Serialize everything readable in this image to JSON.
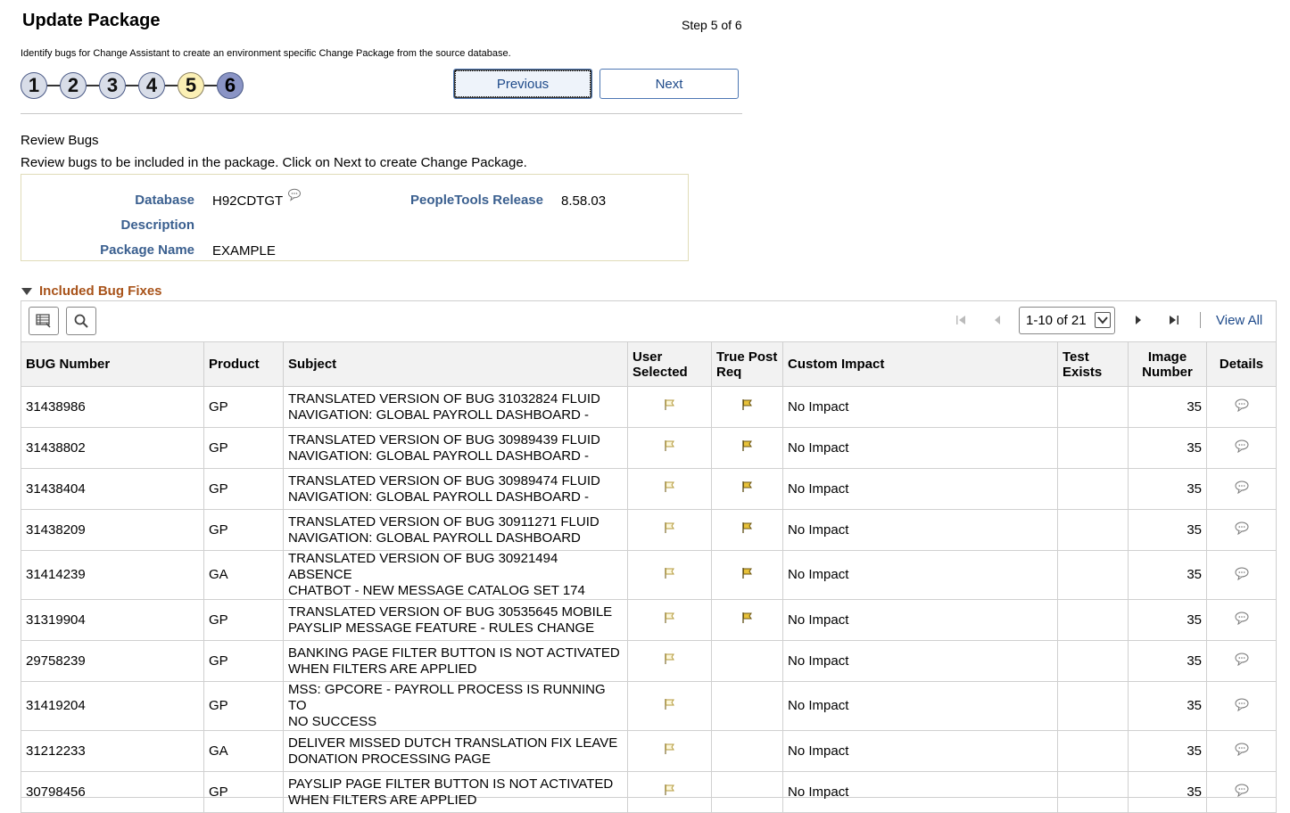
{
  "header": {
    "title": "Update Package",
    "step_text": "Step 5 of 6",
    "instructions": "Identify bugs for Change Assistant to create an environment specific Change Package from the source database."
  },
  "steps": [
    {
      "label": "1",
      "state": "visited"
    },
    {
      "label": "2",
      "state": "visited"
    },
    {
      "label": "3",
      "state": "visited"
    },
    {
      "label": "4",
      "state": "visited"
    },
    {
      "label": "5",
      "state": "current"
    },
    {
      "label": "6",
      "state": "next"
    }
  ],
  "buttons": {
    "previous": "Previous",
    "next": "Next"
  },
  "review": {
    "title": "Review Bugs",
    "description": "Review bugs to be included in the package.  Click on Next to create Change Package."
  },
  "info": {
    "database_label": "Database",
    "database_value": "H92CDTGT",
    "tools_label": "PeopleTools Release",
    "tools_value": "8.58.03",
    "description_label": "Description",
    "description_value": "",
    "package_label": "Package Name",
    "package_value": "EXAMPLE"
  },
  "grid": {
    "section_title": "Included Bug Fixes",
    "pager_text": "1-10 of 21",
    "view_all": "View All",
    "columns": {
      "bug": "BUG Number",
      "product": "Product",
      "subject": "Subject",
      "user_selected_1": "User",
      "user_selected_2": "Selected",
      "true_post_1": "True Post",
      "true_post_2": "Req",
      "custom_impact": "Custom Impact",
      "test_exists_1": "Test",
      "test_exists_2": "Exists",
      "image_number_1": "Image",
      "image_number_2": "Number",
      "details": "Details"
    },
    "rows": [
      {
        "bug": "31438986",
        "product": "GP",
        "subject1": "TRANSLATED VERSION OF BUG 31032824 FLUID",
        "subject2": "NAVIGATION: GLOBAL PAYROLL DASHBOARD -",
        "user_selected": true,
        "true_post": true,
        "impact": "No Impact",
        "test": "",
        "image": "35"
      },
      {
        "bug": "31438802",
        "product": "GP",
        "subject1": "TRANSLATED VERSION OF BUG 30989439 FLUID",
        "subject2": "NAVIGATION: GLOBAL PAYROLL DASHBOARD -",
        "user_selected": true,
        "true_post": true,
        "impact": "No Impact",
        "test": "",
        "image": "35"
      },
      {
        "bug": "31438404",
        "product": "GP",
        "subject1": "TRANSLATED VERSION OF BUG 30989474 FLUID",
        "subject2": "NAVIGATION: GLOBAL PAYROLL DASHBOARD -",
        "user_selected": true,
        "true_post": true,
        "impact": "No Impact",
        "test": "",
        "image": "35"
      },
      {
        "bug": "31438209",
        "product": "GP",
        "subject1": "TRANSLATED VERSION OF BUG 30911271 FLUID",
        "subject2": "NAVIGATION: GLOBAL PAYROLL DASHBOARD",
        "user_selected": true,
        "true_post": true,
        "impact": "No Impact",
        "test": "",
        "image": "35"
      },
      {
        "bug": "31414239",
        "product": "GA",
        "subject1": "TRANSLATED VERSION OF BUG 30921494 ABSENCE",
        "subject2": "CHATBOT - NEW MESSAGE CATALOG SET 174",
        "user_selected": true,
        "true_post": true,
        "impact": "No Impact",
        "test": "",
        "image": "35"
      },
      {
        "bug": "31319904",
        "product": "GP",
        "subject1": "TRANSLATED VERSION OF BUG 30535645 MOBILE",
        "subject2": "PAYSLIP MESSAGE FEATURE - RULES CHANGE",
        "user_selected": true,
        "true_post": true,
        "impact": "No Impact",
        "test": "",
        "image": "35"
      },
      {
        "bug": "29758239",
        "product": "GP",
        "subject1": "BANKING PAGE FILTER BUTTON IS NOT ACTIVATED",
        "subject2": "WHEN FILTERS ARE APPLIED",
        "user_selected": true,
        "true_post": false,
        "impact": "No Impact",
        "test": "",
        "image": "35"
      },
      {
        "bug": "31419204",
        "product": "GP",
        "subject1": "MSS: GPCORE - PAYROLL PROCESS IS RUNNING TO",
        "subject2": "NO SUCCESS",
        "user_selected": true,
        "true_post": false,
        "impact": "No Impact",
        "test": "",
        "image": "35"
      },
      {
        "bug": "31212233",
        "product": "GA",
        "subject1": "DELIVER MISSED DUTCH TRANSLATION FIX LEAVE",
        "subject2": "DONATION PROCESSING PAGE",
        "user_selected": true,
        "true_post": false,
        "impact": "No Impact",
        "test": "",
        "image": "35"
      },
      {
        "bug": "30798456",
        "product": "GP",
        "subject1": "PAYSLIP PAGE FILTER BUTTON IS NOT ACTIVATED",
        "subject2": "WHEN FILTERS ARE APPLIED",
        "user_selected": true,
        "true_post": false,
        "impact": "No Impact",
        "test": "",
        "image": "35"
      }
    ]
  },
  "icons": {
    "flag_user": "flag-outline-icon",
    "flag_true": "flag-filled-icon",
    "details": "comment-bubble-icon"
  },
  "colors": {
    "label_blue": "#3a5f8f",
    "section_orange": "#a8531a",
    "flag_yellow": "#e8c23a"
  }
}
